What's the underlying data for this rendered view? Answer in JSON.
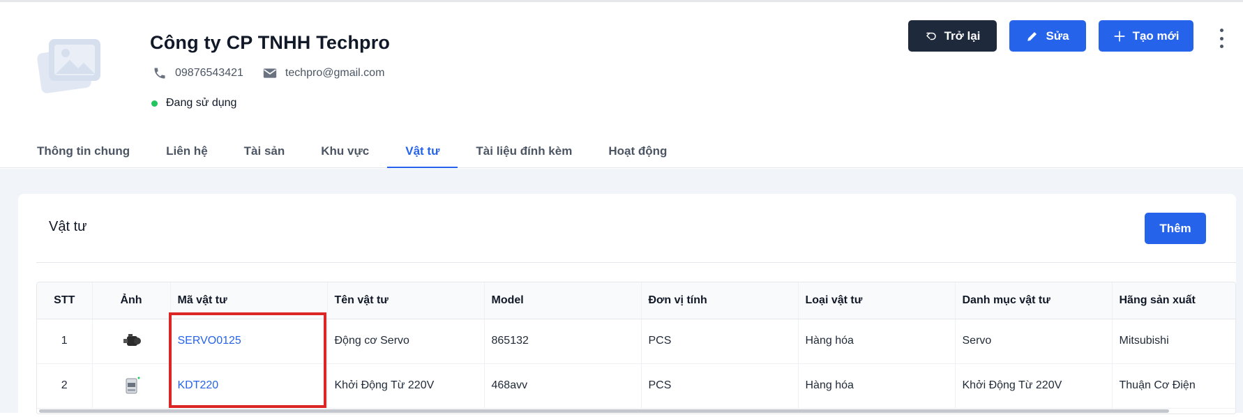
{
  "company": {
    "name": "Công ty CP TNHH Techpro",
    "phone": "09876543421",
    "email": "techpro@gmail.com",
    "status": "Đang sử dụng",
    "status_color": "#22c55e"
  },
  "actions": {
    "back_label": "Trở lại",
    "edit_label": "Sửa",
    "new_label": "Tạo mới"
  },
  "tabs": [
    {
      "label": "Thông tin chung"
    },
    {
      "label": "Liên hệ"
    },
    {
      "label": "Tài sản"
    },
    {
      "label": "Khu vực"
    },
    {
      "label": "Vật tư",
      "active": true
    },
    {
      "label": "Tài liệu đính kèm"
    },
    {
      "label": "Hoạt động"
    }
  ],
  "section": {
    "title": "Vật tư",
    "add_label": "Thêm"
  },
  "table": {
    "columns": [
      "STT",
      "Ảnh",
      "Mã vật tư",
      "Tên vật tư",
      "Model",
      "Đơn vị tính",
      "Loại vật tư",
      "Danh mục vật tư",
      "Hãng sản xuất"
    ],
    "rows": [
      {
        "stt": "1",
        "image_icon": "servo-motor-thumbnail",
        "code": "SERVO0125",
        "name": "Động cơ Servo",
        "model": "865132",
        "unit": "PCS",
        "type": "Hàng hóa",
        "category": "Servo",
        "manufacturer": "Mitsubishi"
      },
      {
        "stt": "2",
        "image_icon": "contactor-thumbnail",
        "code": "KDT220",
        "name": "Khởi Động Từ 220V",
        "model": "468avv",
        "unit": "PCS",
        "type": "Hàng hóa",
        "category": "Khởi Động Từ 220V",
        "manufacturer": "Thuận Cơ Điện"
      }
    ]
  },
  "colors": {
    "primary": "#2563eb",
    "dark_button": "#1e293b",
    "highlight": "#dc2626"
  }
}
